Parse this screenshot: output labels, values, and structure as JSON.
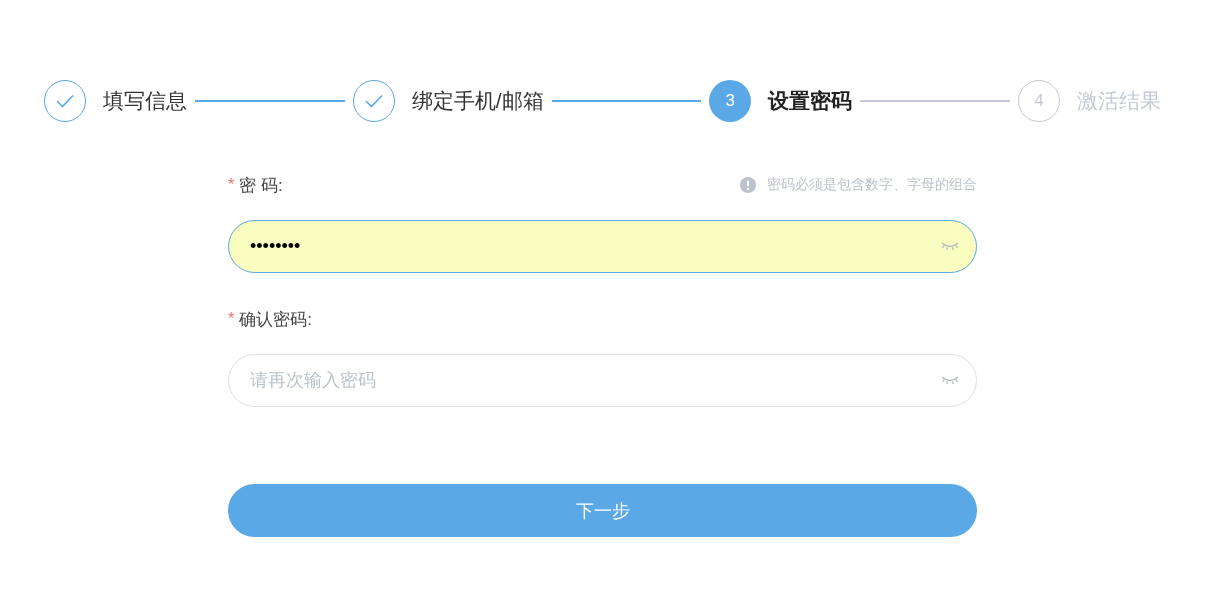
{
  "steps": [
    {
      "label": "填写信息",
      "completed": true,
      "current": false
    },
    {
      "label": "绑定手机/邮箱",
      "completed": true,
      "current": false
    },
    {
      "number": "3",
      "label": "设置密码",
      "completed": false,
      "current": true
    },
    {
      "number": "4",
      "label": "激活结果",
      "completed": false,
      "current": false
    }
  ],
  "form": {
    "fields": [
      {
        "required_mark": "*",
        "label": "密 码:",
        "hint": "密码必须是包含数字、字母的组合",
        "value": "••••••••",
        "focused": true
      },
      {
        "required_mark": "*",
        "label": "确认密码:",
        "placeholder": "请再次输入密码",
        "focused": false
      }
    ],
    "submit": "下一步"
  }
}
